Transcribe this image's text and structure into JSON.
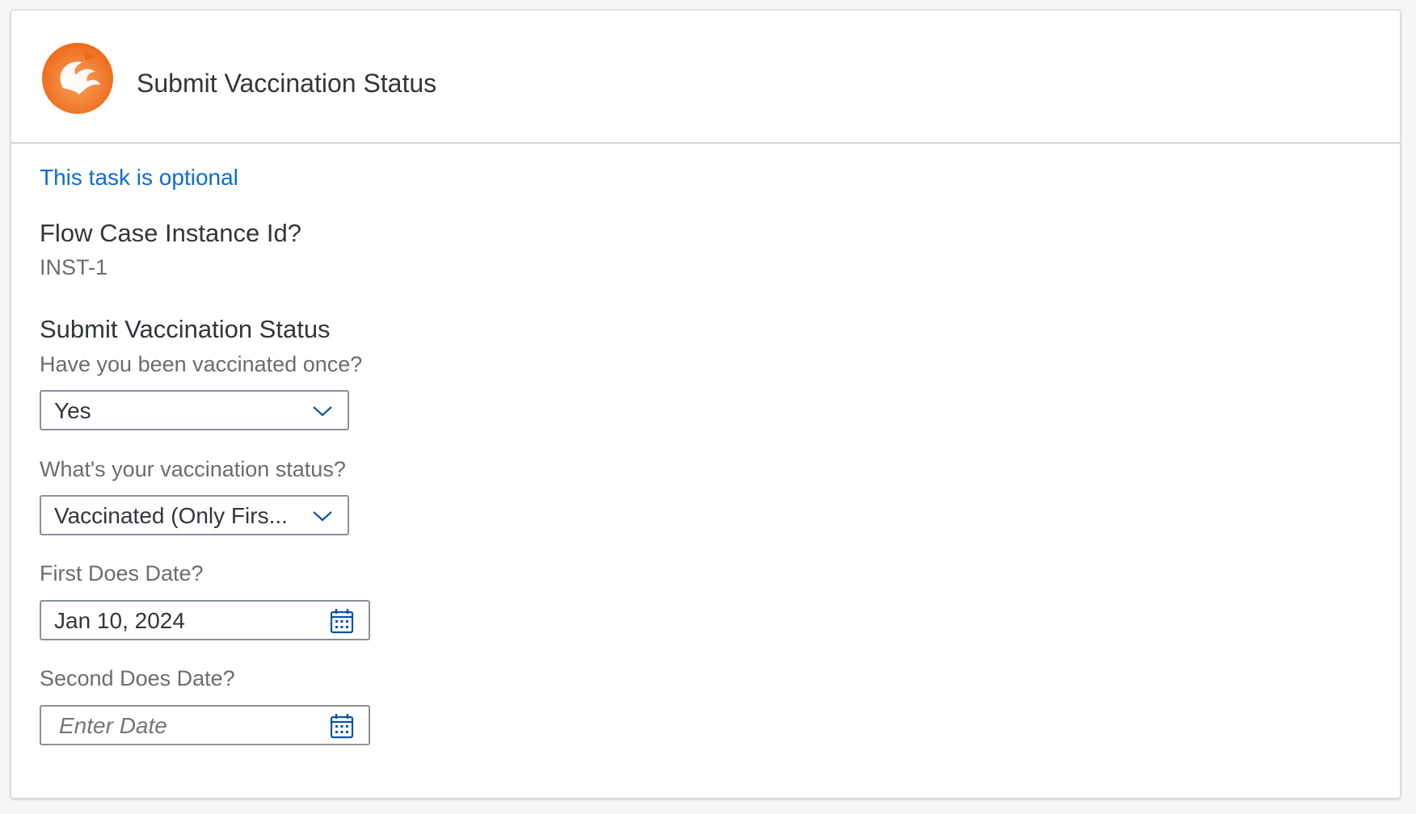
{
  "header": {
    "title": "Submit Vaccination Status",
    "logo_icon": "phoenix-logo-icon"
  },
  "optional_link": "This task is optional",
  "flow_case": {
    "title": "Flow Case Instance Id?",
    "value": "INST-1"
  },
  "form": {
    "title": "Submit Vaccination Status",
    "q1_label": "Have you been vaccinated once?",
    "q1_value": "Yes",
    "q2_label": "What's your vaccination status?",
    "q2_value": "Vaccinated (Only Firs...",
    "first_date_label": "First Does Date?",
    "first_date_value": "Jan 10, 2024",
    "second_date_label": "Second Does Date?",
    "second_date_placeholder": "Enter Date"
  },
  "colors": {
    "accent": "#0a6ed1",
    "icon": "#0854a0",
    "logo_orange": "#f07a1a"
  }
}
